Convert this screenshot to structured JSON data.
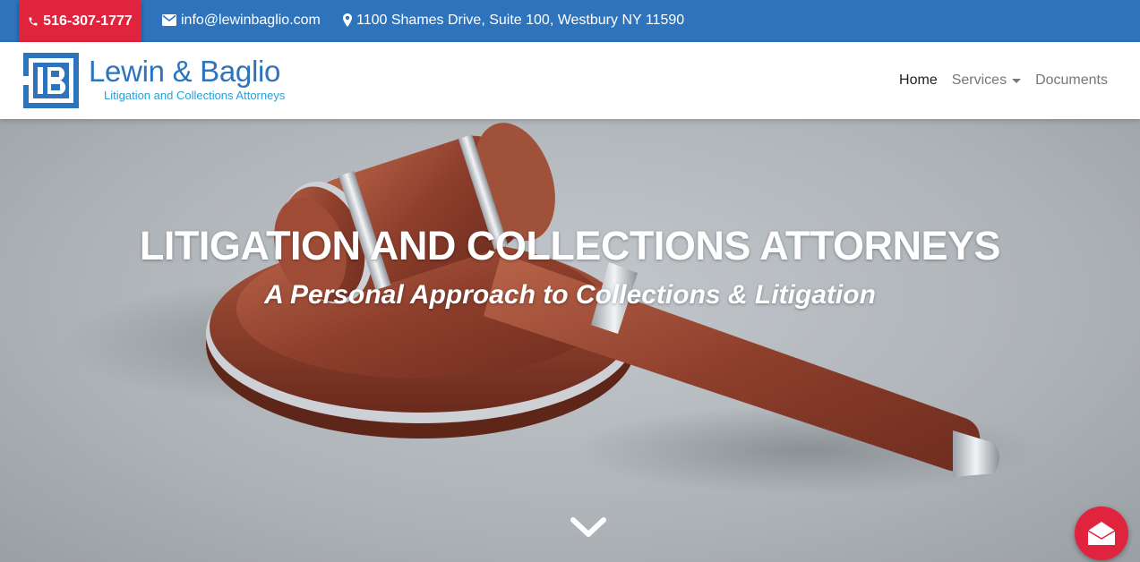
{
  "topbar": {
    "phone": "516-307-1777",
    "email": "info@lewinbaglio.com",
    "address": "1100 Shames Drive, Suite 100, Westbury NY 11590"
  },
  "brand": {
    "name": "Lewin & Baglio",
    "tagline": "Litigation and Collections Attorneys"
  },
  "nav": {
    "home": "Home",
    "services": "Services",
    "documents": "Documents"
  },
  "hero": {
    "title": "LITIGATION AND COLLECTIONS ATTORNEYS",
    "subtitle": "A Personal Approach to Collections & Litigation"
  },
  "icons": {
    "phone": "phone-icon",
    "email": "envelope-icon",
    "address": "map-marker-icon",
    "scroll": "chevron-down-icon",
    "chat": "envelope-open-icon"
  },
  "colors": {
    "primary_blue": "#2d74bd",
    "accent_red": "#e0243e",
    "tagline_blue": "#2a9fd8"
  }
}
